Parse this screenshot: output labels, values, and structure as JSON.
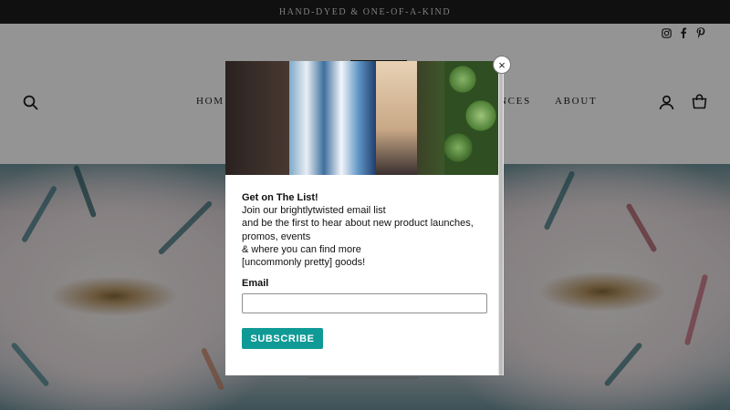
{
  "announcement": {
    "text": "HAND-DYED & ONE-OF-A-KIND"
  },
  "header": {
    "nav": [
      {
        "label": "HOM"
      },
      {
        "label": "NCES"
      },
      {
        "label": "ABOUT"
      }
    ],
    "icons": [
      "search-icon",
      "instagram-icon",
      "facebook-icon",
      "pinterest-icon",
      "account-icon",
      "cart-icon"
    ]
  },
  "popup": {
    "title": "Get on The List!",
    "line1": "Join our brightlytwisted email list",
    "line2": "and be the first to hear about new product launches, promos, events",
    "line3": "& where you can find more",
    "line4": "[uncommonly pretty] goods!",
    "email_label": "Email",
    "email_value": "",
    "subscribe_label": "SUBSCRIBE",
    "close_label": "×",
    "accent": "#0f9a96"
  }
}
